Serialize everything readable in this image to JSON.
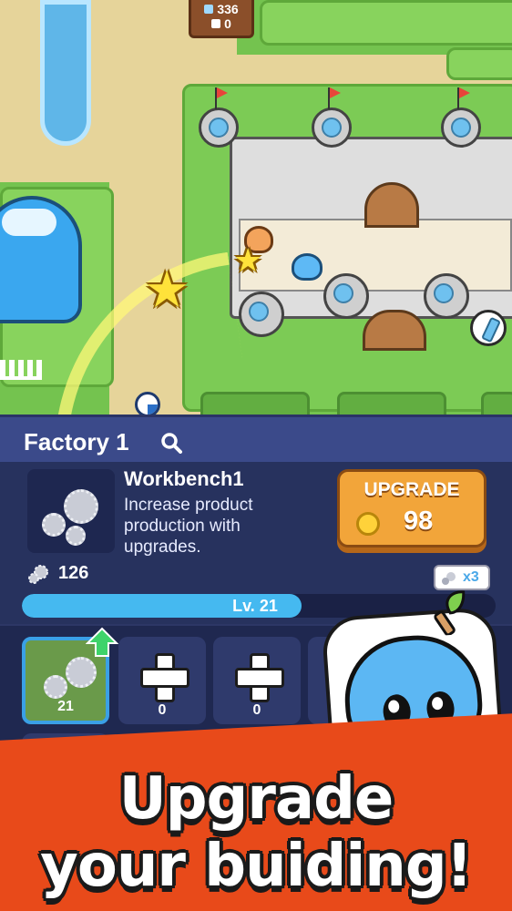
{
  "resources": {
    "gems": "336",
    "potions": "0"
  },
  "panel": {
    "title": "Factory 1",
    "item_name": "Workbench1",
    "item_desc": "Increase product production with upgrades.",
    "upgrade_label": "UPGRADE",
    "upgrade_cost": "98",
    "gear_count": "126",
    "multiplier": "x3",
    "level_label": "Lv. 21",
    "level_progress": 0.59
  },
  "slots": [
    {
      "count": "21",
      "state": "owned"
    },
    {
      "count": "0",
      "state": "locked"
    },
    {
      "count": "0",
      "state": "locked"
    }
  ],
  "banner": {
    "line1": "Upgrade",
    "line2": "your buiding!"
  },
  "colors": {
    "panel": "#2d3766",
    "accent": "#f2a53a",
    "banner": "#e84a1a",
    "progress": "#45b9f0"
  }
}
